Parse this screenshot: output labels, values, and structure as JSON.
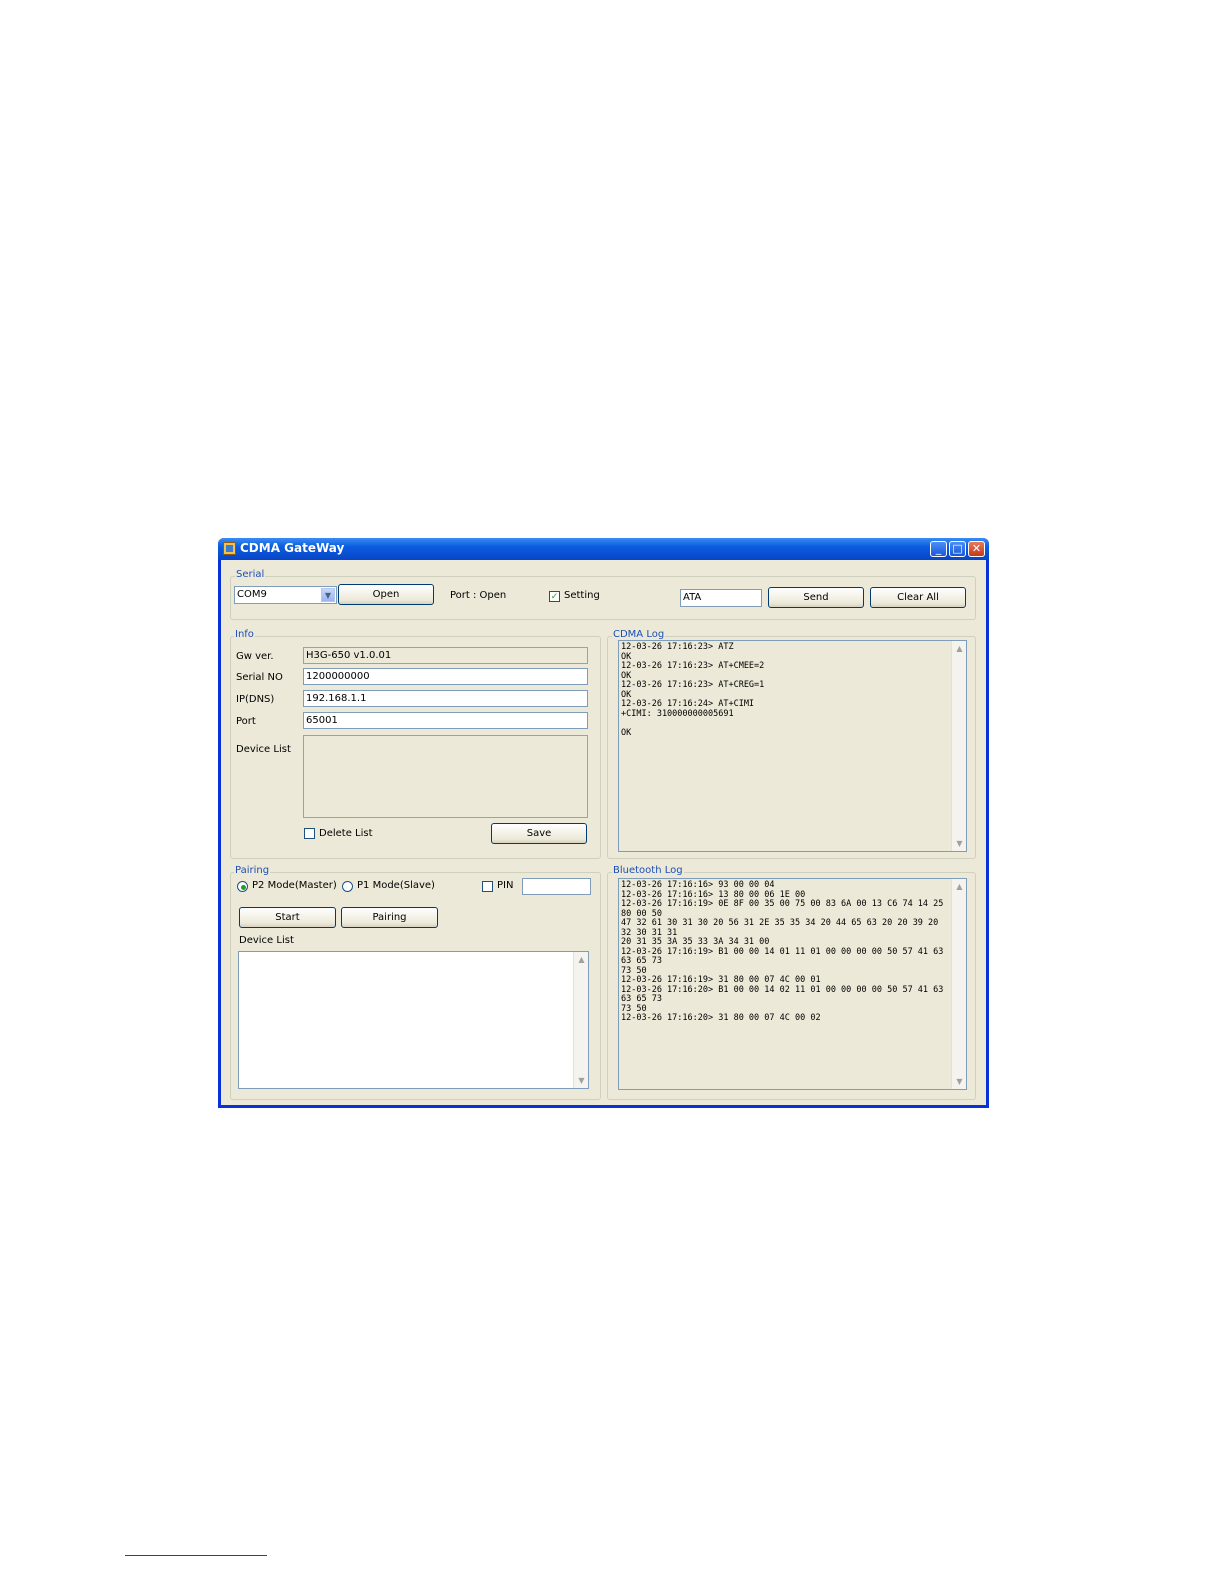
{
  "window": {
    "title": "CDMA GateWay"
  },
  "serial": {
    "label": "Serial",
    "port_select": "COM9",
    "open_button": "Open",
    "port_status": "Port : Open",
    "setting_label": "Setting",
    "setting_checked": true,
    "command_value": "ATA",
    "send_button": "Send",
    "clear_button": "Clear All"
  },
  "info": {
    "label": "Info",
    "gw_ver_label": "Gw ver.",
    "gw_ver_value": "H3G-650 v1.0.01",
    "serial_no_label": "Serial NO",
    "serial_no_value": "1200000000",
    "ip_label": "IP(DNS)",
    "ip_value": "192.168.1.1",
    "port_label": "Port",
    "port_value": "65001",
    "device_list_label": "Device List",
    "delete_list_label": "Delete List",
    "save_button": "Save"
  },
  "pairing": {
    "label": "Pairing",
    "p2_mode_label": "P2 Mode(Master)",
    "p1_mode_label": "P1 Mode(Slave)",
    "selected_mode": "P2 Mode(Master)",
    "pin_label": "PIN",
    "pin_value": "",
    "start_button": "Start",
    "pairing_button": "Pairing",
    "device_list_label": "Device List"
  },
  "cdma_log": {
    "label": "CDMA Log",
    "text": "12-03-26 17:16:23> ATZ\nOK\n12-03-26 17:16:23> AT+CMEE=2\nOK\n12-03-26 17:16:23> AT+CREG=1\nOK\n12-03-26 17:16:24> AT+CIMI\n+CIMI: 310000000005691\n\nOK"
  },
  "bluetooth_log": {
    "label": "Bluetooth Log",
    "text": "12-03-26 17:16:16> 93 00 00 04\n12-03-26 17:16:16> 13 80 00 06 1E 00\n12-03-26 17:16:19> 0E 8F 00 35 00 75 00 83 6A 00 13 C6 74 14 25 80 00 50\n47 32 61 30 31 30 20 56 31 2E 35 35 34 20 44 65 63 20 20 39 20 32 30 31 31\n20 31 35 3A 35 33 3A 34 31 00\n12-03-26 17:16:19> B1 00 00 14 01 11 01 00 00 00 00 50 57 41 63 63 65 73\n73 50\n12-03-26 17:16:19> 31 80 00 07 4C 00 01\n12-03-26 17:16:20> B1 00 00 14 02 11 01 00 00 00 00 50 57 41 63 63 65 73\n73 50\n12-03-26 17:16:20> 31 80 00 07 4C 00 02"
  },
  "icons": {
    "app": "app-icon",
    "minimize": "minimize-icon",
    "maximize": "maximize-icon",
    "close": "close-icon",
    "dropdown": "chevron-down-icon",
    "scroll_up": "scroll-up-arrow-icon",
    "scroll_down": "scroll-down-arrow-icon"
  },
  "colors": {
    "title_bar": "#0a5ce0",
    "window_face": "#ece9d8",
    "group_label": "#1c4fb8",
    "check_mark": "#21a121"
  }
}
